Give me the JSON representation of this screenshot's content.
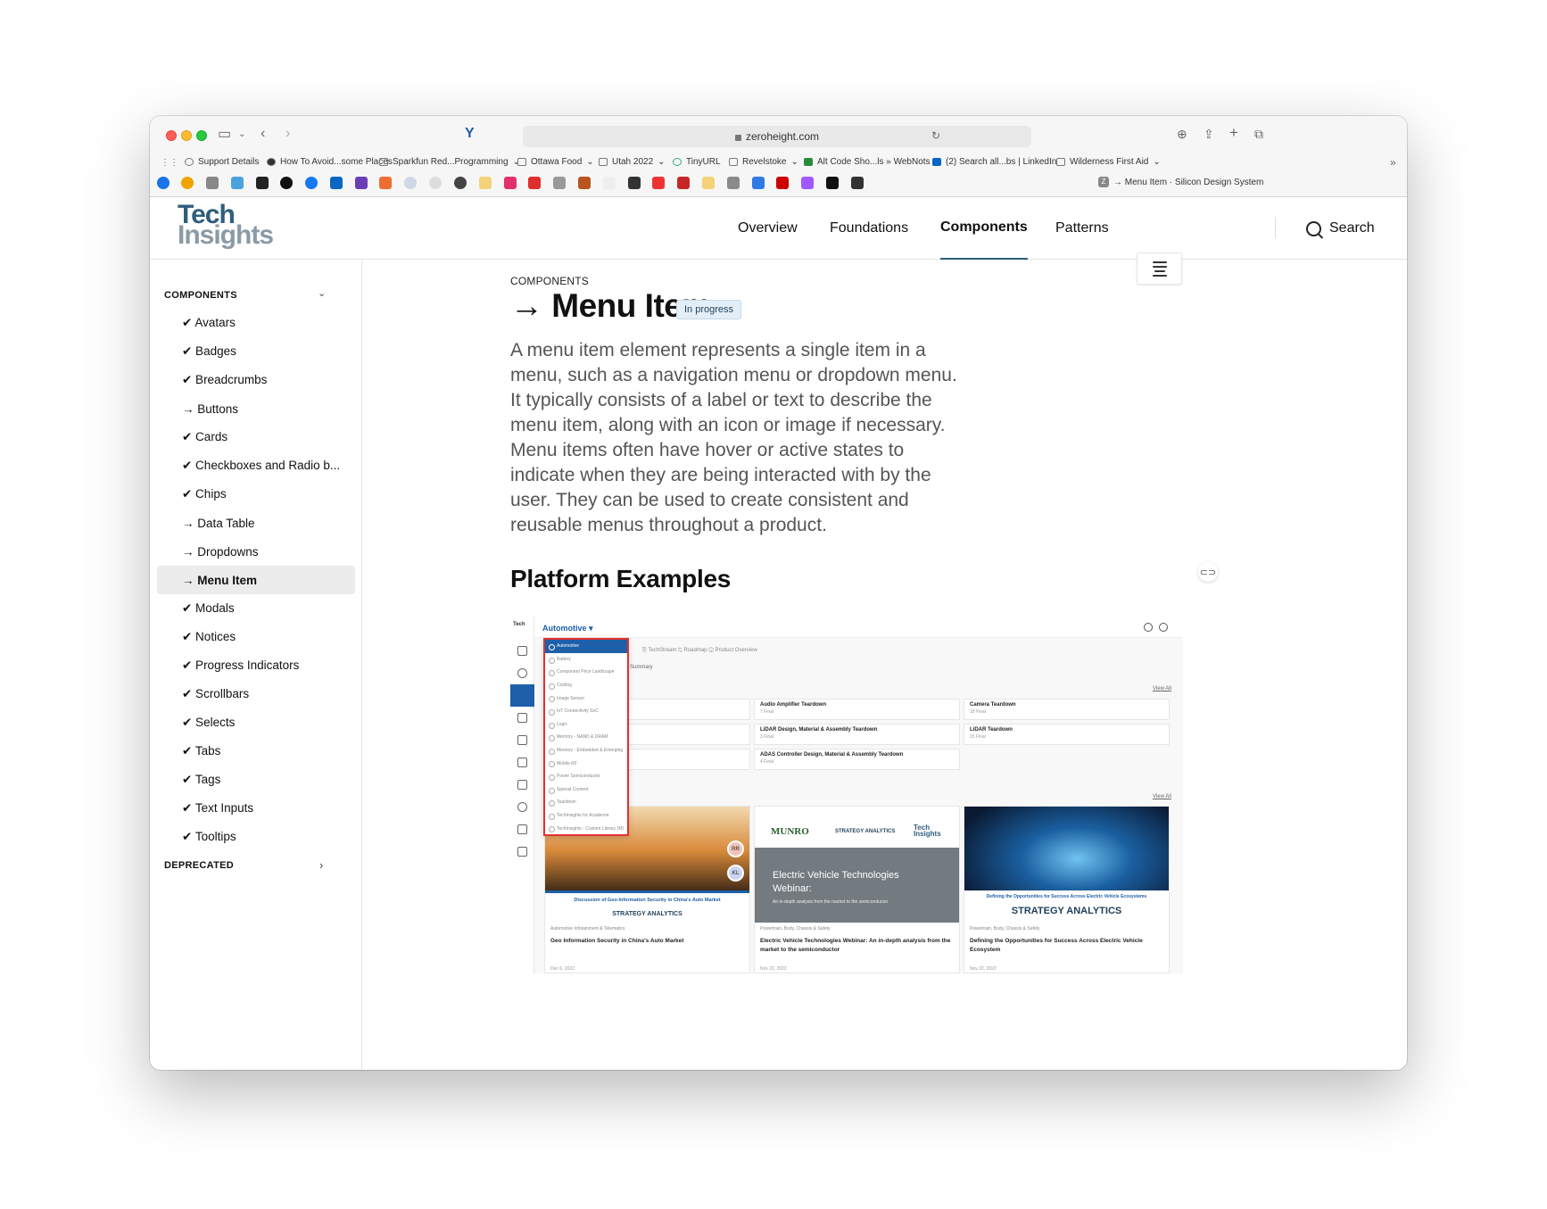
{
  "browser": {
    "url": "zeroheight.com",
    "tab_title": "→ Menu Item · Silicon Design System",
    "bookmarks": [
      "Support Details",
      "How To Avoid...some Places",
      "Sparkfun Red...Programming",
      "Ottawa Food",
      "Utah 2022",
      "TinyURL",
      "Revelstoke",
      "Alt Code Sho...ls » WebNots",
      "(2) Search all...bs | LinkedIn",
      "Wilderness First Aid"
    ]
  },
  "header": {
    "logo_line1": "Tech",
    "logo_line2": "Insights",
    "nav": [
      "Overview",
      "Foundations",
      "Components",
      "Patterns"
    ],
    "active_nav": "Components",
    "search_label": "Search"
  },
  "sidebar": {
    "section_label": "COMPONENTS",
    "items": [
      {
        "label": "✔ Avatars"
      },
      {
        "label": "✔ Badges"
      },
      {
        "label": "✔ Breadcrumbs"
      },
      {
        "label": "→ Buttons"
      },
      {
        "label": "✔ Cards"
      },
      {
        "label": "✔ Checkboxes and Radio b..."
      },
      {
        "label": "✔ Chips"
      },
      {
        "label": "→ Data Table"
      },
      {
        "label": "→ Dropdowns"
      },
      {
        "label": "→ Menu Item"
      },
      {
        "label": "✔ Modals"
      },
      {
        "label": "✔ Notices"
      },
      {
        "label": "✔ Progress Indicators"
      },
      {
        "label": "✔ Scrollbars"
      },
      {
        "label": "✔ Selects"
      },
      {
        "label": "✔ Tabs"
      },
      {
        "label": "✔ Tags"
      },
      {
        "label": "✔ Text Inputs"
      },
      {
        "label": "✔ Tooltips"
      }
    ],
    "active_item": "→ Menu Item",
    "deprecated_label": "DEPRECATED"
  },
  "content": {
    "eyebrow": "COMPONENTS",
    "title": "→ Menu Item",
    "status_badge": "In progress",
    "description": "A menu item element represents a single item in a menu, such as a navigation menu or dropdown menu. It typically consists of a label or text to describe the menu item, along with an icon or image if necessary. Menu items often have hover or active states to indicate when they are being interacted with by the user. They can be used to create consistent and reusable menus throughout a product.",
    "section_heading": "Platform Examples"
  },
  "example": {
    "category_label": "Automotive ▾",
    "tabs": "⎘ TechStream   ⇆ Roadmap   ⓘ Product Overview",
    "summary": "Summary",
    "view_all": "View All",
    "dropdown_items": [
      "Automotive",
      "Battery",
      "Component Price Landscape",
      "Costing",
      "Image Sensor",
      "IoT Connectivity SoC",
      "Logic",
      "Memory - NAND & DRAM",
      "Memory - Embedded & Emerging",
      "Mobile RF",
      "Power Semiconductor",
      "Special Content",
      "Teardown",
      "TechInsights for Academia",
      "TechInsights - Custom Library (M)"
    ],
    "row_cards": [
      {
        "title": "Audio Amplifier Teardown",
        "meta": "7 Final"
      },
      {
        "title": "Camera Teardown",
        "meta": "18 Final"
      },
      {
        "title": "LiDAR Design, Material & Assembly Teardown",
        "meta": "3 Final"
      },
      {
        "title": "LiDAR Teardown",
        "meta": "15 Final"
      },
      {
        "title": "ADAS Controller Design, Material & Assembly Teardown",
        "meta": "4 Final"
      }
    ],
    "cards": [
      {
        "caption": "Discussion of Geo-Information Security in China's Auto Market",
        "brand": "STRATEGY ANALYTICS",
        "tag": "Automotive Infotainment & Telematics",
        "title": "Geo Information Security in China's Auto Market",
        "date": "Dec 6, 2022"
      },
      {
        "banner": "Electric Vehicle Technologies Webinar:",
        "sub": "An in-depth analysis from the market to the semiconductor",
        "logo1": "MUNRO",
        "logo2": "STRATEGY ANALYTICS",
        "logo3": "Tech Insights",
        "tag": "Powertrain, Body, Chassis & Safety",
        "title": "Electric Vehicle Technologies Webinar: An in-depth analysis from the market to the semiconductor",
        "date": "Nov 22, 2022"
      },
      {
        "caption": "Defining the Opportunities for Success Across Electric Vehicle Ecosystems",
        "brand": "STRATEGY ANALYTICS",
        "tag": "Powertrain, Body, Chassis & Safety",
        "title": "Defining the Opportunities for Success Across Electric Vehicle Ecosystem",
        "date": "Nov 22, 2022"
      }
    ],
    "avatars": [
      "RR",
      "KL"
    ]
  }
}
